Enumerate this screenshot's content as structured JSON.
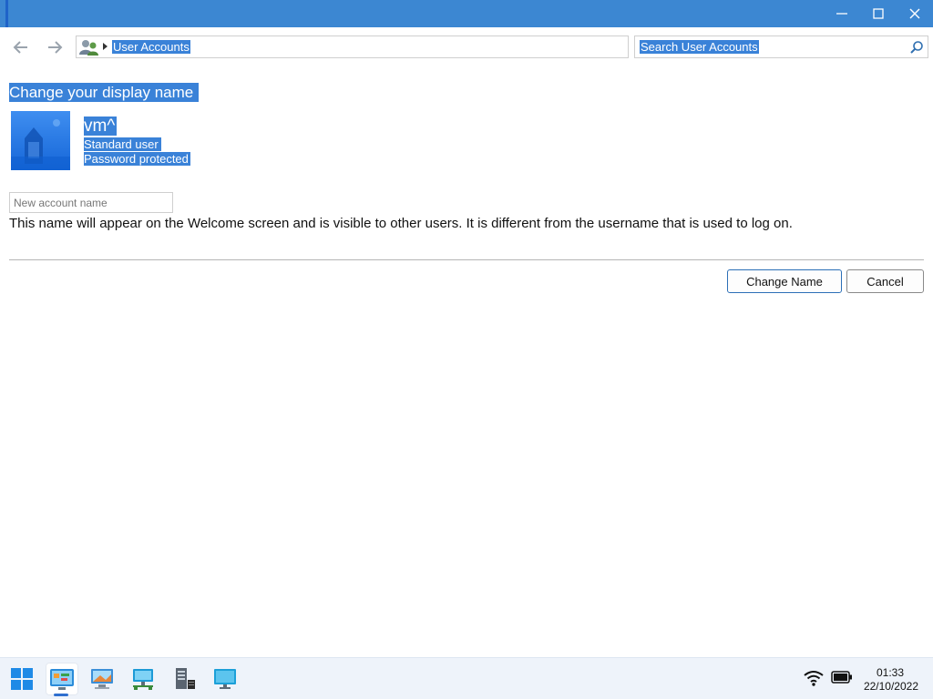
{
  "window": {
    "controls": {
      "minimize_icon": "minimize-icon",
      "maximize_icon": "maximize-icon",
      "close_icon": "close-icon"
    }
  },
  "nav": {
    "back_icon": "back-arrow-icon",
    "forward_icon": "forward-arrow-icon"
  },
  "address_bar": {
    "icon": "user-accounts-icon",
    "breadcrumb": "User Accounts"
  },
  "search": {
    "placeholder": "Search User Accounts",
    "icon": "search-icon"
  },
  "page": {
    "heading": "Change your display name",
    "account": {
      "name": "vm^",
      "type": "Standard user",
      "status": "Password protected"
    },
    "new_name_input": {
      "placeholder": "New account name",
      "value": ""
    },
    "hint": "This name will appear on the Welcome screen and is visible to other users. It is different from the username that is used to log on.",
    "buttons": {
      "change": "Change Name",
      "cancel": "Cancel"
    }
  },
  "taskbar": {
    "items": [
      "start-icon",
      "control-panel-icon",
      "computer-icon",
      "network-icon",
      "server-icon",
      "monitor-icon"
    ],
    "tray": {
      "wifi_icon": "wifi-icon",
      "battery_icon": "battery-icon",
      "time": "01:33",
      "date": "22/10/2022"
    }
  },
  "colors": {
    "titlebar": "#3c87d2",
    "selection": "#3a82d8",
    "taskbar": "#eef3fa"
  }
}
